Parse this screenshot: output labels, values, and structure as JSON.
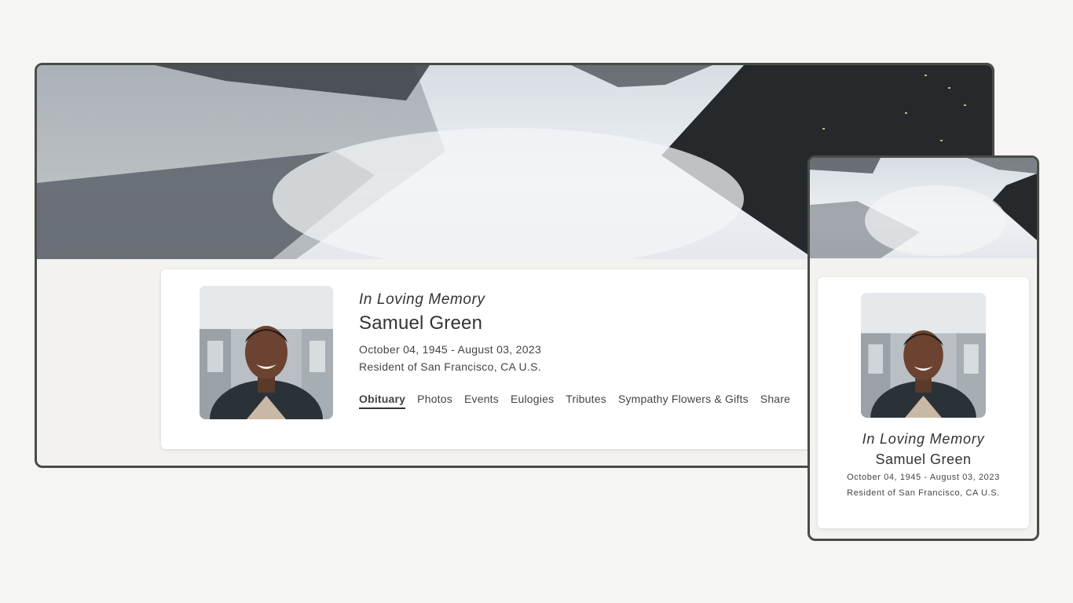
{
  "profile": {
    "memory_label": "In Loving Memory",
    "name": "Samuel Green",
    "dates": "October 04, 1945 - August 03, 2023",
    "residence": "Resident of San Francisco, CA U.S."
  },
  "tabs": [
    {
      "label": "Obituary",
      "active": true
    },
    {
      "label": "Photos",
      "active": false
    },
    {
      "label": "Events",
      "active": false
    },
    {
      "label": "Eulogies",
      "active": false
    },
    {
      "label": "Tributes",
      "active": false
    },
    {
      "label": "Sympathy Flowers & Gifts",
      "active": false
    },
    {
      "label": "Share",
      "active": false
    }
  ],
  "colors": {
    "frame_border": "#494c47",
    "page_background": "#f5f5f4",
    "content_background": "#f3f2ef",
    "card": "#ffffff",
    "text": "#333333"
  },
  "icons": {
    "banner": "skyscrapers-banner-image",
    "portrait": "portrait-photo"
  }
}
